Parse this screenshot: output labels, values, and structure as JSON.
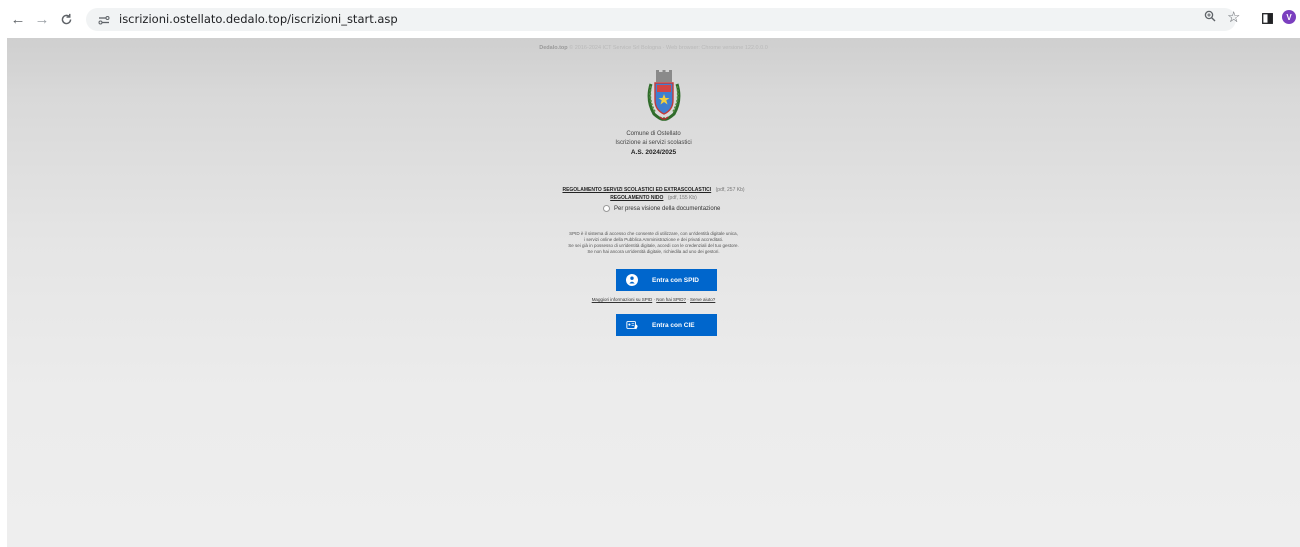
{
  "browser": {
    "url": "iscrizioni.ostellato.dedalo.top/iscrizioni_start.asp",
    "avatar_letter": "V",
    "icons": {
      "back": "arrow-left-icon",
      "forward": "arrow-right-icon",
      "reload": "reload-icon",
      "site_info": "site-settings-icon",
      "zoom": "zoom-icon",
      "bookmark": "star-icon",
      "side_panel": "side-panel-icon"
    }
  },
  "page": {
    "header_brand": "Dedalo.top",
    "header_text": "© 2016-2024 ICT Service Srl Bologna · Web browser: Chrome versione 122.0.0.0",
    "crest_icon": "municipal-crest-icon",
    "comune": "Comune di Ostellato",
    "subtitle": "Iscrizione ai servizi scolastici",
    "anno": "A.S. 2024/2025",
    "documents": [
      {
        "label": "REGOLAMENTO SERVIZI SCOLASTICI ED EXTRASCOLASTICI",
        "size": "(pdf, 257 Kb)"
      },
      {
        "label": "REGOLAMENTO NIDO",
        "size": "(pdf, 155 Kb)"
      }
    ],
    "acknowledge_label": "Per presa visione della documentazione",
    "spid_info": [
      "SPID è il sistema di accesso che consente di utilizzare, con un'identità digitale unica,",
      "i servizi online della Pubblica Amministrazione e dei privati accreditati.",
      "Se sei già in possesso di un'identità digitale, accedi con le credenziali del tuo gestore.",
      "Se non hai ancora un'identità digitale, richiedila ad uno dei gestori."
    ],
    "spid_button": "Entra con SPID",
    "help_links": [
      "Maggiori informazioni su SPID",
      "Non hai SPID?",
      "Serve aiuto?"
    ],
    "cie_button": "Entra con CIE",
    "colors": {
      "button_blue": "#0066cc",
      "avatar_purple": "#7b3fbf"
    }
  }
}
